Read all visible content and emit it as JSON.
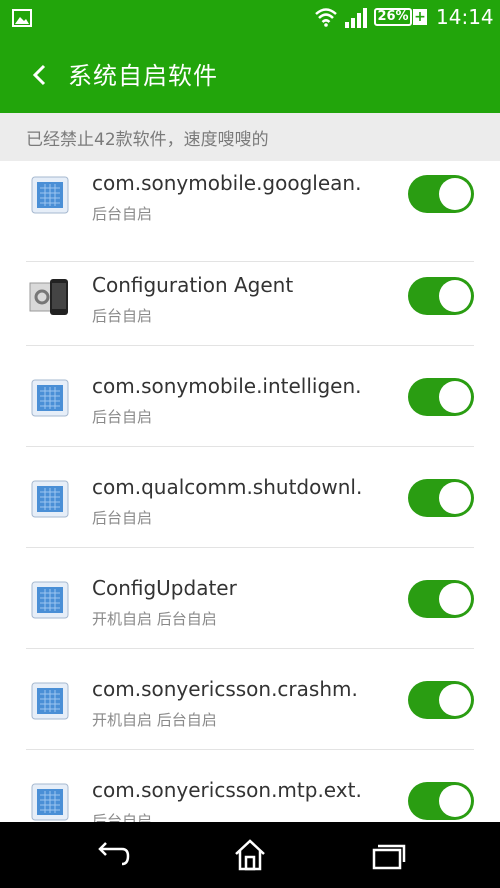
{
  "status": {
    "battery": "26%",
    "time": "14:14"
  },
  "header": {
    "title": "系统自启软件"
  },
  "summary": "已经禁止42款软件，速度嗖嗖的",
  "apps": [
    {
      "name": "com.sonymobile.googlean.",
      "sub": "后台自启",
      "icon": "android-app-icon",
      "enabled": true
    },
    {
      "name": "Configuration Agent",
      "sub": "后台自启",
      "icon": "configuration-agent-icon",
      "enabled": true
    },
    {
      "name": "com.sonymobile.intelligen.",
      "sub": "后台自启",
      "icon": "android-app-icon",
      "enabled": true
    },
    {
      "name": "com.qualcomm.shutdownl.",
      "sub": "后台自启",
      "icon": "android-app-icon",
      "enabled": true
    },
    {
      "name": "ConfigUpdater",
      "sub": "开机自启 后台自启",
      "icon": "android-app-icon",
      "enabled": true
    },
    {
      "name": "com.sonyericsson.crashm.",
      "sub": "开机自启 后台自启",
      "icon": "android-app-icon",
      "enabled": true
    },
    {
      "name": "com.sonyericsson.mtp.ext.",
      "sub": "后台自启",
      "icon": "android-app-icon",
      "enabled": true
    }
  ],
  "nav": {
    "buttons": [
      "back-icon",
      "home-icon",
      "recents-icon"
    ]
  }
}
